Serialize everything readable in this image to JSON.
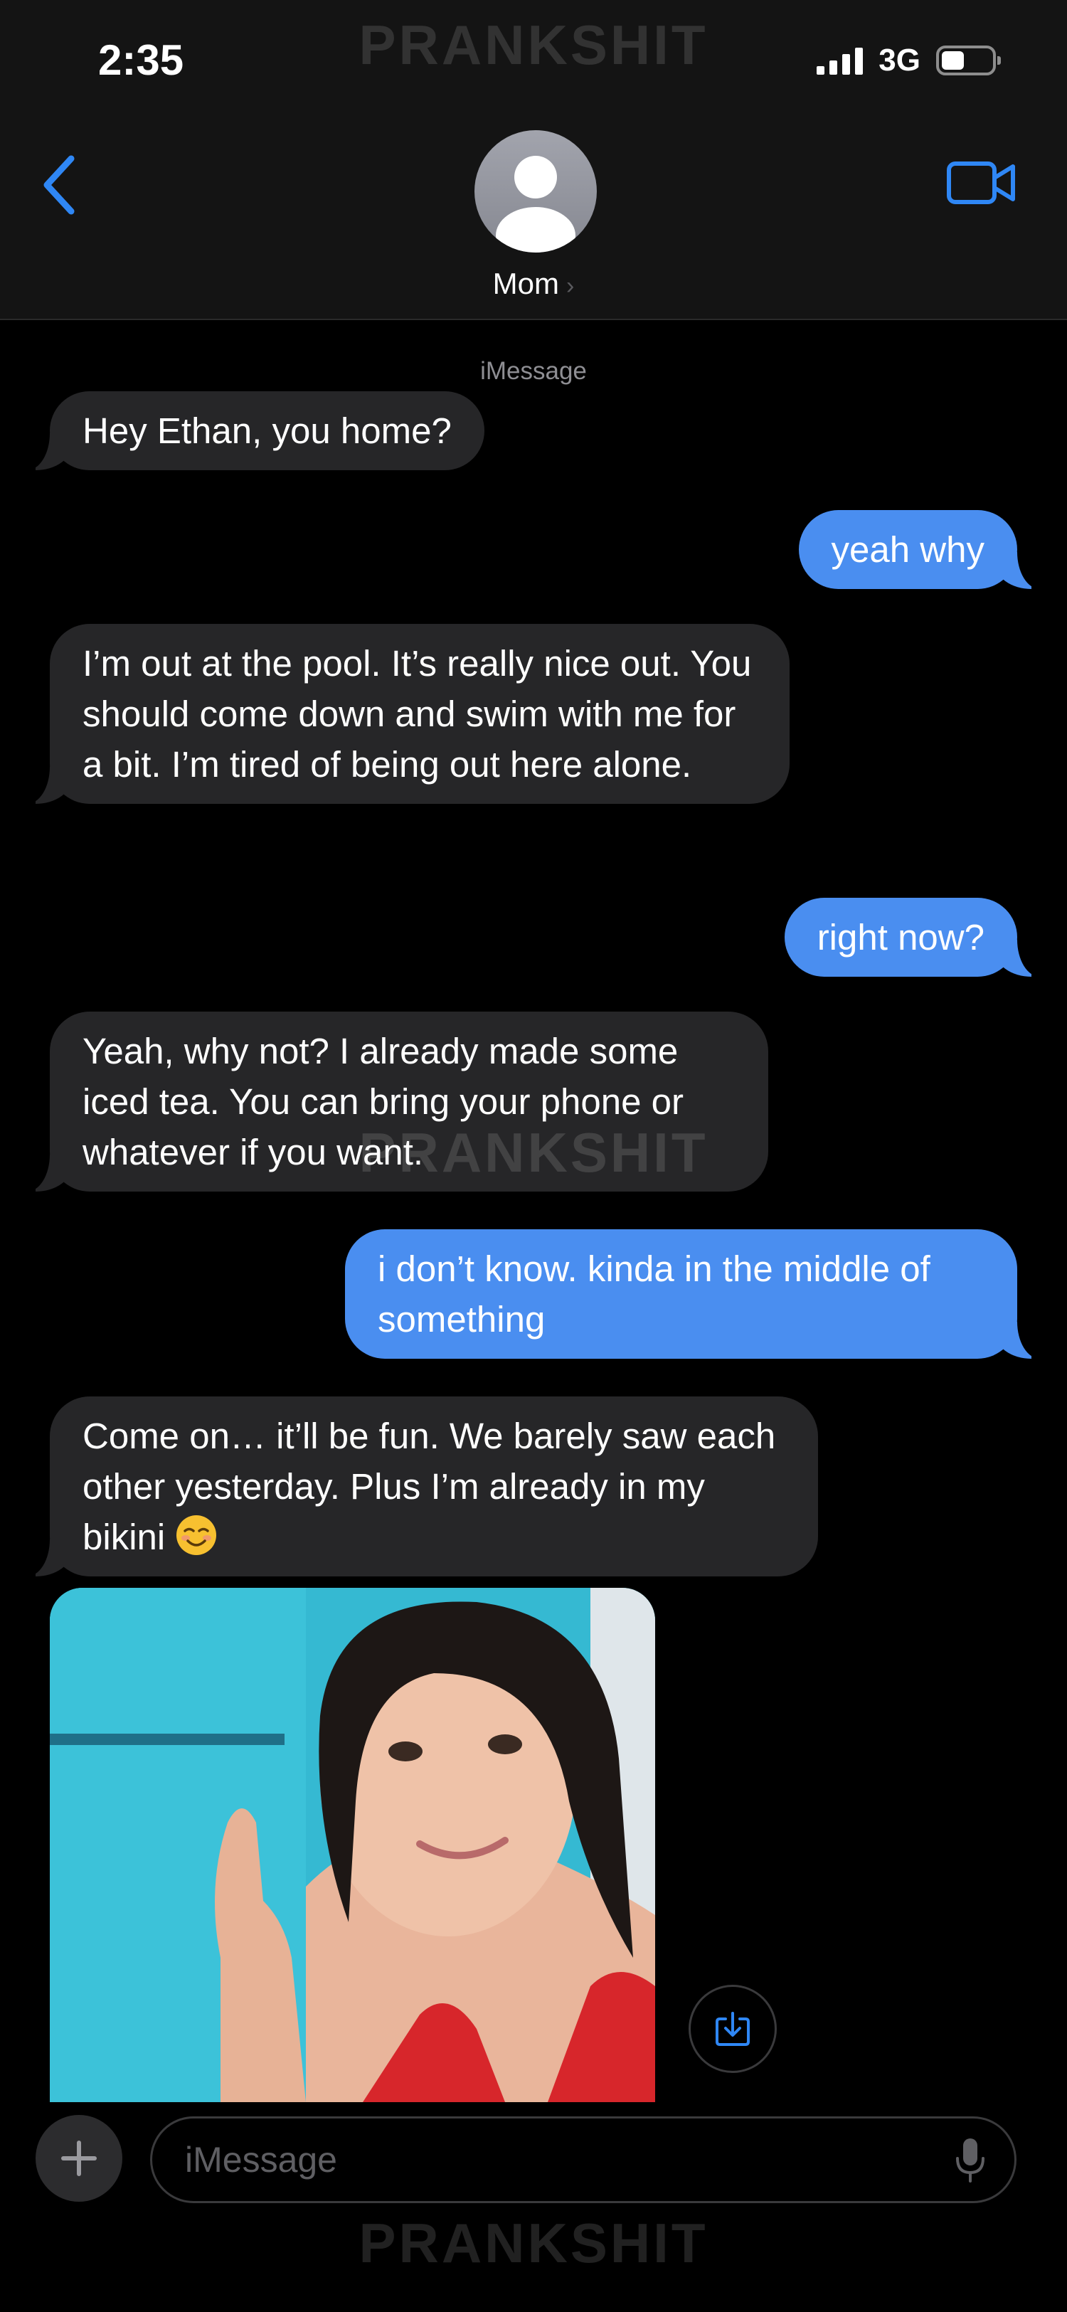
{
  "status_bar": {
    "time": "2:35",
    "network": "3G",
    "battery_level": 0.46
  },
  "header": {
    "contact_name": "Mom",
    "chevron": "›"
  },
  "watermark": "PRANKSHIT",
  "service_label": "iMessage",
  "messages": [
    {
      "direction": "incoming",
      "text": "Hey Ethan, you home?"
    },
    {
      "direction": "outgoing",
      "text": "yeah why"
    },
    {
      "direction": "incoming",
      "text": "I’m out at the pool. It’s really nice out. You should come down and swim with me for a bit. I’m tired of being out here alone."
    },
    {
      "direction": "outgoing",
      "text": "right now?"
    },
    {
      "direction": "incoming",
      "text": "Yeah, why not? I already made some iced tea. You can bring your phone or whatever if you want."
    },
    {
      "direction": "outgoing",
      "text": "i don’t know. kinda in the middle of something"
    },
    {
      "direction": "incoming",
      "text": "Come on… it’ll be fun. We barely saw each other yesterday. Plus I’m already in my bikini",
      "emoji": "smiling-face-icon"
    },
    {
      "direction": "incoming",
      "type": "image",
      "image": "pool-selfie-photo"
    }
  ],
  "input": {
    "placeholder": "iMessage"
  },
  "icons": {
    "back": "chevron-left-icon",
    "video": "video-camera-icon",
    "save": "download-icon",
    "add": "plus-icon",
    "mic": "microphone-icon"
  },
  "colors": {
    "accent": "#2f87f5",
    "outgoing_bubble": "#4a8ef0",
    "incoming_bubble": "#262628"
  }
}
